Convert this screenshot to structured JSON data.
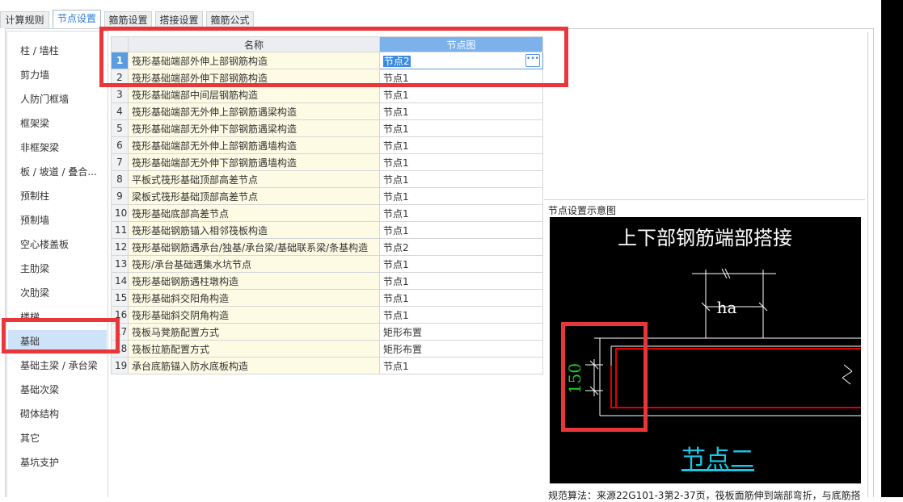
{
  "tabs": [
    {
      "label": "计算规则",
      "active": false
    },
    {
      "label": "节点设置",
      "active": true
    },
    {
      "label": "箍筋设置",
      "active": false
    },
    {
      "label": "搭接设置",
      "active": false
    },
    {
      "label": "箍筋公式",
      "active": false
    }
  ],
  "sidebar": {
    "items": [
      {
        "label": "柱 / 墙柱"
      },
      {
        "label": "剪力墙"
      },
      {
        "label": "人防门框墙"
      },
      {
        "label": "框架梁"
      },
      {
        "label": "非框架梁"
      },
      {
        "label": "板 / 坡道 / 叠合..."
      },
      {
        "label": "预制柱"
      },
      {
        "label": "预制墙"
      },
      {
        "label": "空心楼盖板"
      },
      {
        "label": "主肋梁"
      },
      {
        "label": "次肋梁"
      },
      {
        "label": "楼梯"
      },
      {
        "label": "基础",
        "selected": true
      },
      {
        "label": "基础主梁 / 承台梁"
      },
      {
        "label": "基础次梁"
      },
      {
        "label": "砌体结构"
      },
      {
        "label": "其它"
      },
      {
        "label": "基坑支护"
      }
    ]
  },
  "grid": {
    "headers": {
      "name": "名称",
      "node": "节点图"
    },
    "rows": [
      {
        "num": "1",
        "name": "筏形基础端部外伸上部钢筋构造",
        "node": "节点2"
      },
      {
        "num": "2",
        "name": "筏形基础端部外伸下部钢筋构造",
        "node": "节点1"
      },
      {
        "num": "3",
        "name": "筏形基础端部中间层钢筋构造",
        "node": "节点1"
      },
      {
        "num": "4",
        "name": "筏形基础端部无外伸上部钢筋遇梁构造",
        "node": "节点1"
      },
      {
        "num": "5",
        "name": "筏形基础端部无外伸下部钢筋遇梁构造",
        "node": "节点1"
      },
      {
        "num": "6",
        "name": "筏形基础端部无外伸上部钢筋遇墙构造",
        "node": "节点1"
      },
      {
        "num": "7",
        "name": "筏形基础端部无外伸下部钢筋遇墙构造",
        "node": "节点1"
      },
      {
        "num": "8",
        "name": "平板式筏形基础顶部高差节点",
        "node": "节点1"
      },
      {
        "num": "9",
        "name": "梁板式筏形基础顶部高差节点",
        "node": "节点1"
      },
      {
        "num": "10",
        "name": "筏形基础底部高差节点",
        "node": "节点1"
      },
      {
        "num": "11",
        "name": "筏形基础钢筋锚入相邻筏板构造",
        "node": "节点1"
      },
      {
        "num": "12",
        "name": "筏形基础钢筋遇承台/独基/承台梁/基础联系梁/条基构造",
        "node": "节点2"
      },
      {
        "num": "13",
        "name": "筏形/承台基础遇集水坑节点",
        "node": "节点1"
      },
      {
        "num": "14",
        "name": "筏形基础钢筋遇柱墩构造",
        "node": "节点1"
      },
      {
        "num": "15",
        "name": "筏形基础斜交阳角构造",
        "node": "节点1"
      },
      {
        "num": "16",
        "name": "筏形基础斜交阴角构造",
        "node": "节点1"
      },
      {
        "num": "17",
        "name": "筏板马凳筋配置方式",
        "node": "矩形布置"
      },
      {
        "num": "18",
        "name": "筏板拉筋配置方式",
        "node": "矩形布置"
      },
      {
        "num": "19",
        "name": "承台底筋锚入防水底板构造",
        "node": "节点1"
      }
    ]
  },
  "diagram": {
    "panel_title": "节点设置示意图",
    "heading": "上下部钢筋端部搭接",
    "dim_ha": "ha",
    "dim_150": "150",
    "node_label": "节点二",
    "caption": "规范算法：来源22G101-3第2-37页，筏板面筋伸到端部弯折，与底筋搭"
  },
  "colors": {
    "accent": "#2a7bd6",
    "annotation": "#e8363a",
    "rebar": "#e00000",
    "dim_green": "#22cc22",
    "node_cyan": "#19c6e6"
  }
}
